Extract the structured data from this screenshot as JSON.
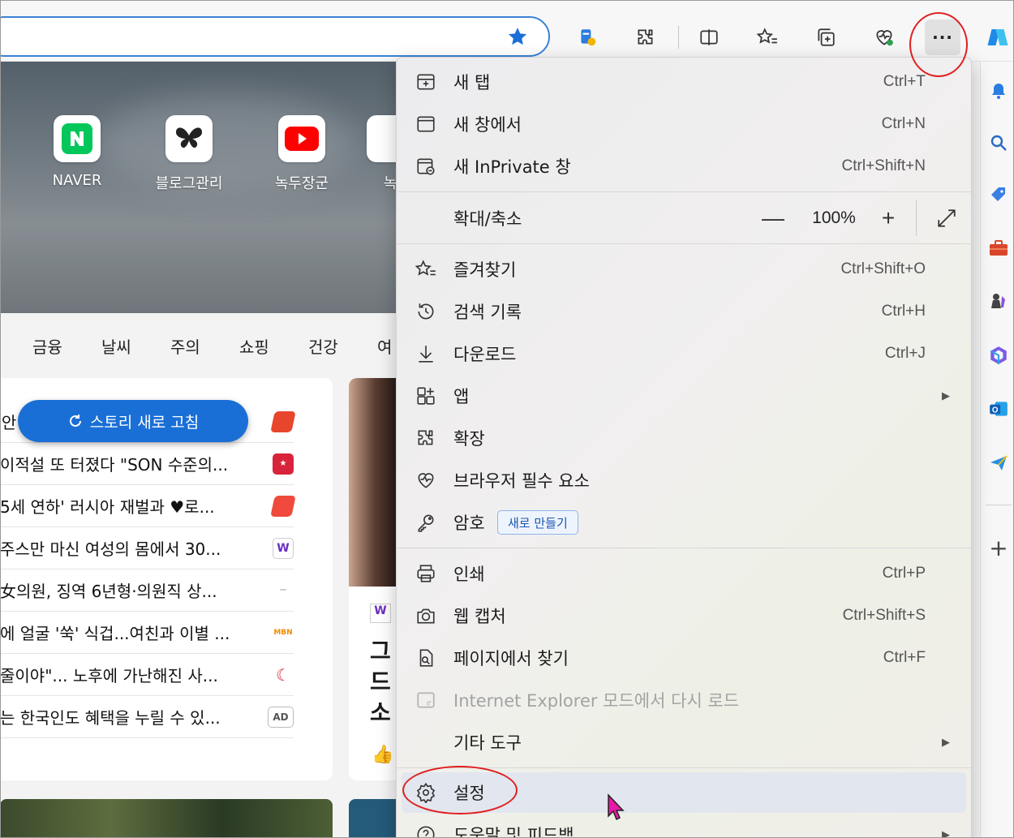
{
  "quick_links": [
    {
      "label": "NAVER",
      "icon": "naver-icon"
    },
    {
      "label": "블로그관리",
      "icon": "butterfly-icon"
    },
    {
      "label": "녹두장군",
      "icon": "youtube-icon"
    },
    {
      "label": "녹",
      "icon": "partial-tile-icon"
    }
  ],
  "categories": [
    "금융",
    "날씨",
    "주의",
    "쇼핑",
    "건강",
    "여"
  ],
  "refresh_label": "스토리 새로 고침",
  "feed": [
    {
      "text": "' 안",
      "logo_color": "#e8462c"
    },
    {
      "text": "이적설 또 터졌다 \"SON 수준의...",
      "logo_color": "#d8243a"
    },
    {
      "text": "5세 연하' 러시아 재벌과 ♥로...",
      "logo_color": "#ef4a3b"
    },
    {
      "text": "주스만 마신 여성의 몸에서 30...",
      "logo_color": "#6a2fc0"
    },
    {
      "text": "女의원, 징역 6년형·의원직 상...",
      "logo_color": "#9aa0a8"
    },
    {
      "text": "에 얼굴 '쑥' 식겁...여친과 이별 ...",
      "logo_color": "#f08a00"
    },
    {
      "text": "줄이야\"... 노후에 가난해진 사...",
      "logo_color": "#d8243a"
    },
    {
      "text": "는 한국인도 혜택을 누릴 수 있...",
      "logo_color": "#ffffff",
      "logo_text": "AD"
    }
  ],
  "card2_partial": "그\n드\n소",
  "menu": {
    "items": [
      {
        "label": "새 탭",
        "shortcut": "Ctrl+T",
        "icon": "new-tab-icon"
      },
      {
        "label": "새 창에서",
        "shortcut": "Ctrl+N",
        "icon": "new-window-icon"
      },
      {
        "label": "새 InPrivate 창",
        "shortcut": "Ctrl+Shift+N",
        "icon": "inprivate-icon"
      },
      {
        "label": "확대/축소",
        "zoom": "100%",
        "zoom_minus": "—",
        "zoom_plus": "+"
      },
      {
        "label": "즐겨찾기",
        "shortcut": "Ctrl+Shift+O",
        "icon": "favorites-icon"
      },
      {
        "label": "검색 기록",
        "shortcut": "Ctrl+H",
        "icon": "history-icon"
      },
      {
        "label": "다운로드",
        "shortcut": "Ctrl+J",
        "icon": "download-icon"
      },
      {
        "label": "앱",
        "arrow": "▶",
        "icon": "apps-icon"
      },
      {
        "label": "확장",
        "icon": "extensions-icon"
      },
      {
        "label": "브라우저 필수 요소",
        "icon": "browser-essentials-icon"
      },
      {
        "label": "암호",
        "badge": "새로 만들기",
        "icon": "password-key-icon"
      },
      {
        "label": "인쇄",
        "shortcut": "Ctrl+P",
        "icon": "print-icon"
      },
      {
        "label": "웹 캡처",
        "shortcut": "Ctrl+Shift+S",
        "icon": "web-capture-icon"
      },
      {
        "label": "페이지에서 찾기",
        "shortcut": "Ctrl+F",
        "icon": "find-in-page-icon"
      },
      {
        "label": "Internet Explorer 모드에서 다시 로드",
        "disabled": true,
        "icon": "ie-mode-icon"
      },
      {
        "label": "기타 도구",
        "arrow": "▶",
        "icon": ""
      },
      {
        "label": "설정",
        "icon": "settings-gear-icon",
        "highlighted": true
      },
      {
        "label": "도움말 및 피드백",
        "arrow": "▶",
        "icon": "help-icon"
      }
    ]
  },
  "colors": {
    "accent": "#1a6fd6",
    "annotation": "#e02020",
    "menu_hover": "#e2e6ee"
  }
}
